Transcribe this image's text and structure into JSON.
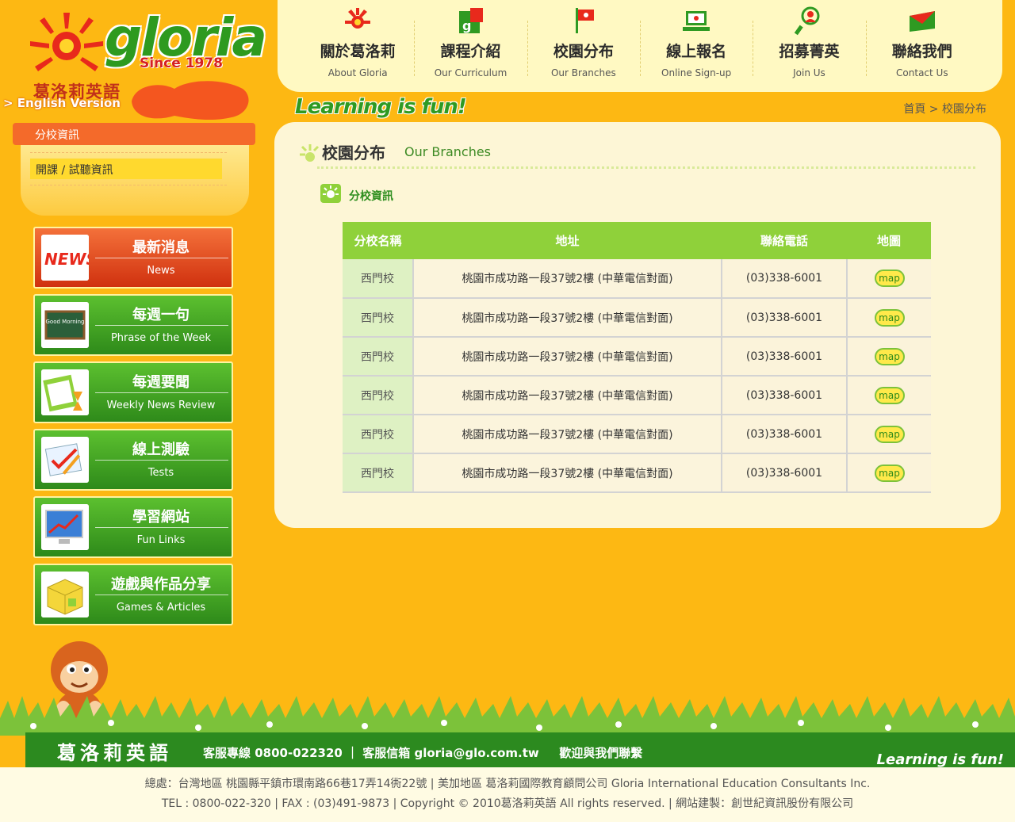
{
  "logo": {
    "brand": "gloria",
    "since": "Since 1978",
    "chinese_name": "葛洛莉英語",
    "english_link": "> English Version"
  },
  "nav": [
    {
      "cn": "關於葛洛莉",
      "en": "About Gloria",
      "icon": "sun-icon"
    },
    {
      "cn": "課程介紹",
      "en": "Our Curriculum",
      "icon": "book-icon"
    },
    {
      "cn": "校園分布",
      "en": "Our Branches",
      "icon": "flag-icon"
    },
    {
      "cn": "線上報名",
      "en": "Online Sign-up",
      "icon": "laptop-icon"
    },
    {
      "cn": "招募菁英",
      "en": "Join Us",
      "icon": "person-search-icon"
    },
    {
      "cn": "聯絡我們",
      "en": "Contact Us",
      "icon": "envelope-icon"
    }
  ],
  "slogan": "Learning is fun!",
  "breadcrumb": "首頁 > 校園分布",
  "submenu": {
    "header": "分校資訊",
    "item": "開課 / 試聽資訊"
  },
  "side_menu": [
    {
      "cn": "最新消息",
      "en": "News",
      "style": "red",
      "thumb": "NEWS"
    },
    {
      "cn": "每週一句",
      "en": "Phrase of the Week",
      "style": "green",
      "thumb": "Good Morning"
    },
    {
      "cn": "每週要聞",
      "en": "Weekly News Review",
      "style": "green",
      "thumb": ""
    },
    {
      "cn": "線上測驗",
      "en": "Tests",
      "style": "green",
      "thumb": ""
    },
    {
      "cn": "學習網站",
      "en": "Fun Links",
      "style": "green",
      "thumb": ""
    },
    {
      "cn": "遊戲與作品分享",
      "en": "Games & Articles",
      "style": "green",
      "thumb": ""
    }
  ],
  "content": {
    "title": "校園分布",
    "title_en": "Our Branches",
    "section": "分校資訊"
  },
  "table": {
    "headers": [
      "分校名稱",
      "地址",
      "聯絡電話",
      "地圖"
    ],
    "map_label": "map",
    "rows": [
      {
        "name": "西門校",
        "address": "桃園市成功路一段37號2樓 (中華電信對面)",
        "phone": "(03)338-6001"
      },
      {
        "name": "西門校",
        "address": "桃園市成功路一段37號2樓 (中華電信對面)",
        "phone": "(03)338-6001"
      },
      {
        "name": "西門校",
        "address": "桃園市成功路一段37號2樓 (中華電信對面)",
        "phone": "(03)338-6001"
      },
      {
        "name": "西門校",
        "address": "桃園市成功路一段37號2樓 (中華電信對面)",
        "phone": "(03)338-6001"
      },
      {
        "name": "西門校",
        "address": "桃園市成功路一段37號2樓 (中華電信對面)",
        "phone": "(03)338-6001"
      },
      {
        "name": "西門校",
        "address": "桃園市成功路一段37號2樓 (中華電信對面)",
        "phone": "(03)338-6001"
      }
    ]
  },
  "footer": {
    "brand": "葛洛莉英語",
    "contact": "客服專線 0800-022320 ｜ 客服信箱 gloria@glo.com.tw 　 歡迎與我們聯繫",
    "slogan": "Learning is fun!",
    "line1": "總處：台灣地區 桃園縣平鎮市環南路66巷17弄14衖22號 | 美加地區 葛洛莉國際教育顧問公司 Gloria International Education Consultants Inc.",
    "line2": "TEL : 0800-022-320 | FAX : (03)491-9873 | Copyright © 2010葛洛莉英語 All rights reserved. | 網站建製：創世紀資訊股份有限公司"
  },
  "colors": {
    "background": "#fdb813",
    "brand_green": "#2e9a1f",
    "header_green": "#8fd13a",
    "accent_orange": "#f46a2a"
  }
}
